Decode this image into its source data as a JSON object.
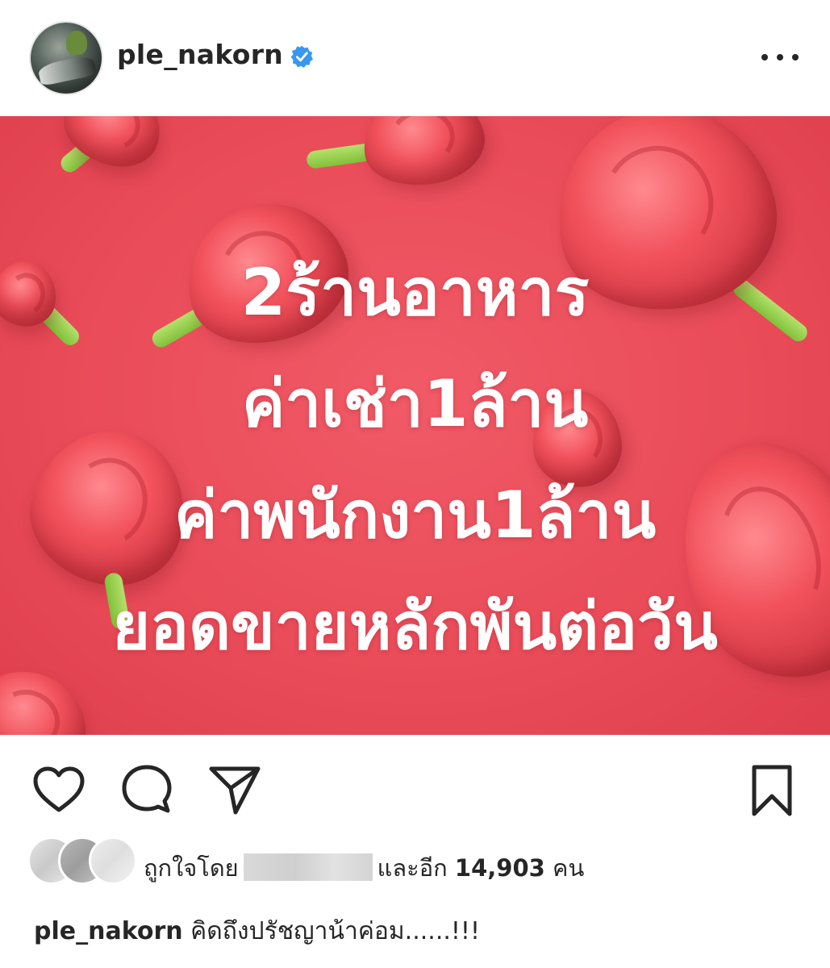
{
  "header": {
    "username": "ple_nakorn",
    "verified": true
  },
  "post_image": {
    "lines": [
      "2ร้านอาหาร",
      "ค่าเช่า1ล้าน",
      "ค่าพนักงาน1ล้าน",
      "ยอดขายหลักพันต่อวัน"
    ],
    "background_color": "#ea4c59",
    "text_color": "#ffffff",
    "decoration": "red-roses"
  },
  "actions": {
    "icons": [
      "heart-icon",
      "comment-icon",
      "share-icon",
      "bookmark-icon"
    ]
  },
  "likes": {
    "prefix": "ถูกใจโดย",
    "middle": "และอีก",
    "count": "14,903",
    "suffix": "คน"
  },
  "caption": {
    "username": "ple_nakorn",
    "text": "คิดถึงปรัชญาน้าค่อม......!!!"
  },
  "colors": {
    "verified_badge": "#3897f0",
    "text_primary": "#262626"
  }
}
